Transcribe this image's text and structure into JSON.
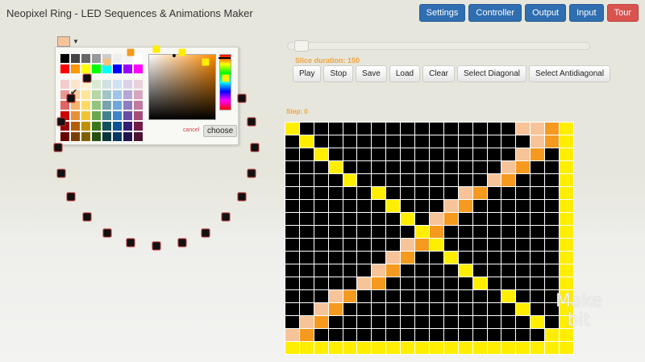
{
  "app": {
    "title": "Neopixel Ring - LED Sequences & Animations Maker"
  },
  "nav": [
    {
      "label": "Settings",
      "color": "#2f6eb0"
    },
    {
      "label": "Controller",
      "color": "#2f6eb0"
    },
    {
      "label": "Output",
      "color": "#2f6eb0"
    },
    {
      "label": "Input",
      "color": "#2f6eb0"
    },
    {
      "label": "Tour",
      "color": "#d9534f"
    }
  ],
  "color_picker": {
    "selected_color": "#f7c49a",
    "cancel_label": "cancel",
    "choose_label": "choose",
    "palette": [
      [
        "#000000",
        "#444444",
        "#666666",
        "#999999",
        "#cccccc",
        "#eeeeee",
        "#f3f3f3",
        "#ffffff"
      ],
      [
        "#ff0000",
        "#ff9900",
        "#ffff00",
        "#00ff00",
        "#00ffff",
        "#0000ff",
        "#9900ff",
        "#ff00ff"
      ],
      [
        "#f4cccc",
        "#fce5cd",
        "#fff2cc",
        "#d9ead3",
        "#d0e0e3",
        "#cfe2f3",
        "#d9d2e9",
        "#ead1dc"
      ],
      [
        "#ea9999",
        "#f9cb9c",
        "#ffe599",
        "#b6d7a8",
        "#a2c4c9",
        "#9fc5e8",
        "#b4a7d6",
        "#d5a6bd"
      ],
      [
        "#e06666",
        "#f6b26b",
        "#ffd966",
        "#93c47d",
        "#76a5af",
        "#6fa8dc",
        "#8e7cc3",
        "#c27ba0"
      ],
      [
        "#cc0000",
        "#e69138",
        "#f1c232",
        "#6aa84f",
        "#45818e",
        "#3d85c6",
        "#674ea7",
        "#a64d79"
      ],
      [
        "#990000",
        "#b45f06",
        "#bf9000",
        "#38761d",
        "#134f5c",
        "#0b5394",
        "#351c75",
        "#741b47"
      ],
      [
        "#660000",
        "#783f04",
        "#7f6000",
        "#274e13",
        "#0c343d",
        "#073763",
        "#20124d",
        "#4c1130"
      ]
    ]
  },
  "ring": {
    "led_count": 24,
    "leds": [
      "#ffee00",
      "#ffee00",
      "#ffee00",
      "#ffee00",
      "#111111",
      "#111111",
      "#111111",
      "#111111",
      "#111111",
      "#111111",
      "#111111",
      "#111111",
      "#111111",
      "#111111",
      "#111111",
      "#111111",
      "#111111",
      "#111111",
      "#111111",
      "#111111",
      "#111111",
      "#111111",
      "#f4c07c",
      "#f59a1e"
    ]
  },
  "sequence": {
    "slice_duration_label": "Slice duration: 150",
    "step_label": "Step: 0",
    "buttons": [
      "Play",
      "Stop",
      "Save",
      "Load",
      "Clear",
      "Select Diagonal",
      "Select Antidiagonal"
    ]
  },
  "matrix": {
    "cols": 20,
    "rows": 18,
    "colors": {
      "off": "#000000",
      "yellow": "#ffee00",
      "peach": "#f7c49a",
      "orange": "#f59a1e"
    }
  },
  "watermark": {
    "line1": "Make",
    "line2": "bit"
  }
}
